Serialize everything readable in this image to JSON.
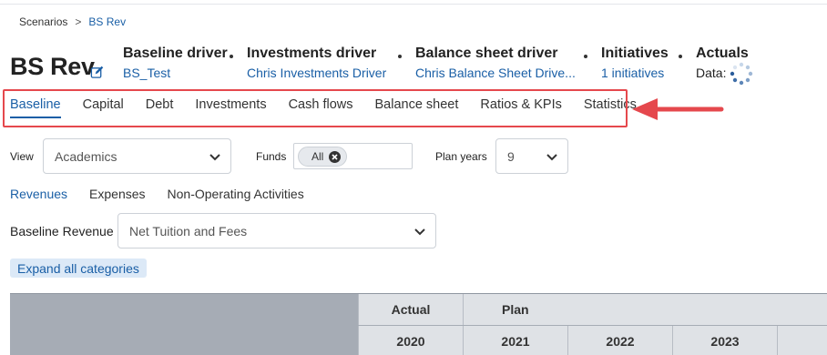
{
  "breadcrumb": {
    "root": "Scenarios",
    "separator": ">",
    "current": "BS Rev"
  },
  "page_title": "BS Rev",
  "meta": {
    "baseline": {
      "label": "Baseline driver",
      "value": "BS_Test"
    },
    "investments": {
      "label": "Investments driver",
      "value": "Chris Investments Driver"
    },
    "balance_sheet": {
      "label": "Balance sheet driver",
      "value": "Chris Balance Sheet Drive..."
    },
    "initiatives": {
      "label": "Initiatives",
      "value": "1 initiatives"
    },
    "actuals": {
      "label": "Actuals",
      "value": "Data:"
    }
  },
  "tabs": [
    {
      "label": "Baseline",
      "active": true
    },
    {
      "label": "Capital",
      "active": false
    },
    {
      "label": "Debt",
      "active": false
    },
    {
      "label": "Investments",
      "active": false
    },
    {
      "label": "Cash flows",
      "active": false
    },
    {
      "label": "Balance sheet",
      "active": false
    },
    {
      "label": "Ratios & KPIs",
      "active": false
    },
    {
      "label": "Statistics",
      "active": false
    }
  ],
  "filters": {
    "view_label": "View",
    "view_value": "Academics",
    "funds_label": "Funds",
    "funds_chip": "All",
    "plan_years_label": "Plan years",
    "plan_years_value": "9"
  },
  "subtabs": [
    {
      "label": "Revenues",
      "active": true
    },
    {
      "label": "Expenses",
      "active": false
    },
    {
      "label": "Non-Operating Activities",
      "active": false
    }
  ],
  "baseline_revenue": {
    "label": "Baseline Revenue",
    "value": "Net Tuition and Fees"
  },
  "expand_button": "Expand all categories",
  "table": {
    "group_actual": "Actual",
    "group_plan": "Plan",
    "years": [
      "2020",
      "2021",
      "2022",
      "2023"
    ]
  },
  "colors": {
    "accent": "#1a5fa6",
    "annotation": "#e5484d",
    "header_bg": "#dfe2e6",
    "table_bg": "#a6acb5"
  }
}
